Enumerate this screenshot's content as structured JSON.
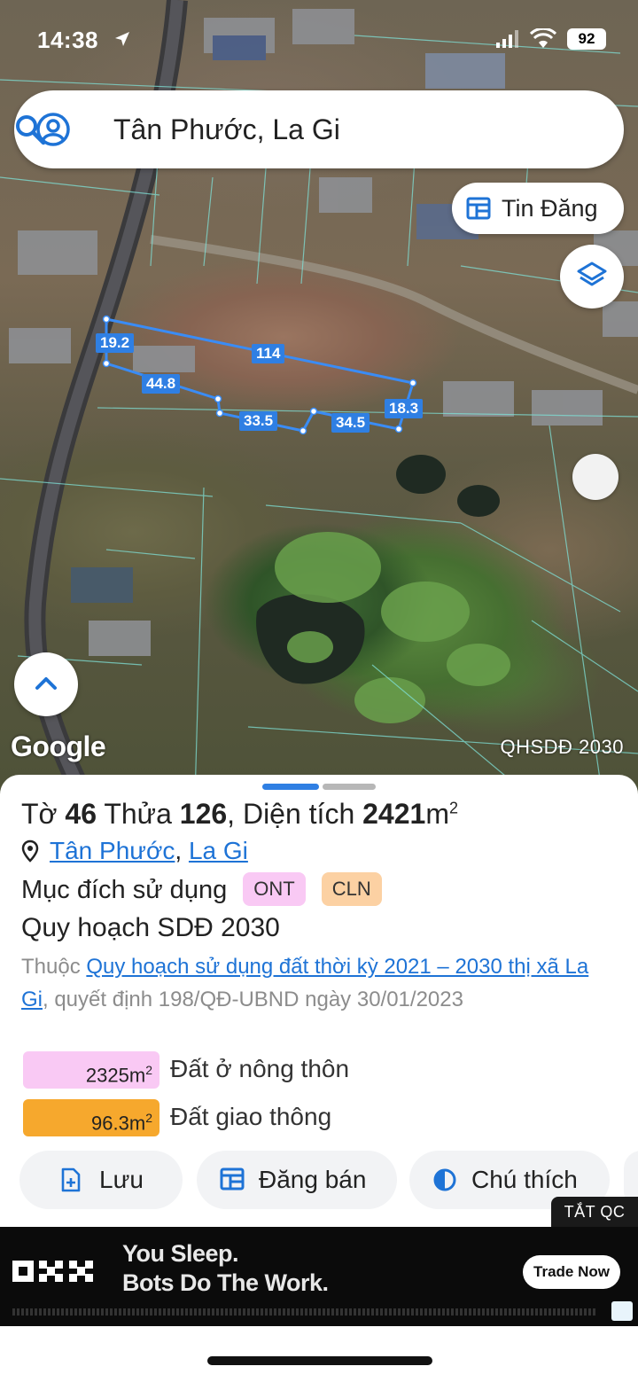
{
  "status_bar": {
    "time": "14:38",
    "battery": "92"
  },
  "search": {
    "query": "Tân Phước, La Gi"
  },
  "map": {
    "listing_button_label": "Tin Đăng",
    "overlay_label": "QHSDĐ 2030",
    "logo_text": "Google",
    "edge_lengths": [
      "19.2",
      "114",
      "44.8",
      "33.5",
      "34.5",
      "18.3"
    ]
  },
  "parcel": {
    "sheet_label": "Tờ",
    "sheet_no": "46",
    "parcel_label": "Thửa",
    "parcel_no": "126",
    "area_label": "Diện tích",
    "area_value": "2421",
    "area_unit": "m",
    "area_exp": "2",
    "ward": "Tân Phước",
    "separator": ",",
    "town": "La Gi",
    "purpose_label": "Mục đích sử dụng",
    "purpose_tags": [
      "ONT",
      "CLN"
    ],
    "plan_title": "Quy hoạch SDĐ 2030",
    "plan_prefix": "Thuộc",
    "plan_link": "Quy hoạch sử dụng đất thời kỳ 2021 – 2030 thị xã La Gi",
    "plan_suffix": ", quyết định 198/QĐ-UBND ngày 30/01/2023",
    "areas": [
      {
        "value": "2325",
        "unit": "m",
        "exp": "2",
        "label": "Đất ở nông thôn",
        "color": "#f9c9f4"
      },
      {
        "value": "96.3",
        "unit": "m",
        "exp": "2",
        "label": "Đất giao thông",
        "color": "#f6a82d"
      }
    ]
  },
  "actions": {
    "save": "Lưu",
    "post_sale": "Đăng bán",
    "legend": "Chú thích"
  },
  "ad": {
    "close_label": "TẮT QC",
    "headline_1": "You Sleep.",
    "headline_2": "Bots Do The Work.",
    "cta": "Trade Now"
  },
  "colors": {
    "accent": "#2f7fe3",
    "link": "#1e73d6",
    "ont": "#f9c9f4",
    "cln": "#fcd1a3",
    "transport": "#f6a82d"
  }
}
